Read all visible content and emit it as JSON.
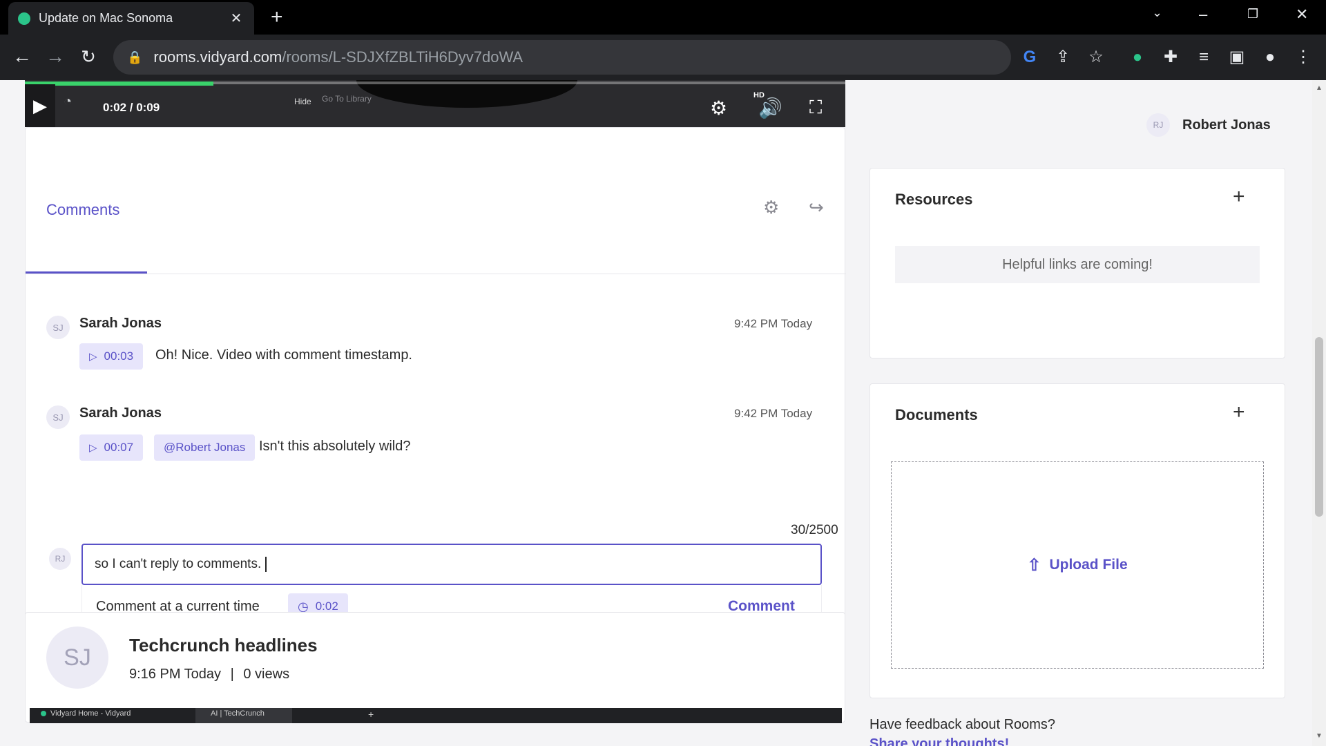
{
  "browser": {
    "tab_title": "Update on Mac Sonoma",
    "tab_close": "✕",
    "new_tab": "+",
    "url_domain": "rooms.vidyard.com",
    "url_path": "/rooms/L-SDJXfZBLTiH6Dyv7doWA"
  },
  "video": {
    "current_time": "0:02 / 0:09",
    "progress": 0.23,
    "hide_label": "Hide",
    "library_label": "Go To Library",
    "hd_label": "HD"
  },
  "comments": {
    "tab_label": "Comments",
    "items": [
      {
        "initials": "SJ",
        "author": "Sarah Jonas",
        "time": "9:42 PM Today",
        "timestamp": "00:03",
        "text": "Oh! Nice. Video with comment timestamp."
      },
      {
        "initials": "SJ",
        "author": "Sarah Jonas",
        "time": "9:42 PM Today",
        "timestamp": "00:07",
        "mention": "@Robert Jonas",
        "text": "Isn't this absolutely wild?"
      }
    ],
    "counter": "30/2500",
    "reply_initials": "RJ",
    "reply_value": "so I can't reply to comments.",
    "current_time_label": "Comment at a current time",
    "current_time_value": "0:02",
    "submit_label": "Comment"
  },
  "next_video": {
    "initials": "SJ",
    "title": "Techcrunch headlines",
    "time": "9:16 PM Today",
    "separator": "|",
    "views": "0 views",
    "thumb_tab1": "Vidyard Home - Vidyard",
    "thumb_tab2": "AI | TechCrunch",
    "thumb_url": "techcrunch.com/category/artificial-intelligence/"
  },
  "sidebar": {
    "user_initials": "RJ",
    "user_name": "Robert Jonas",
    "resources_title": "Resources",
    "resources_empty": "Helpful links are coming!",
    "documents_title": "Documents",
    "upload_label": "Upload File",
    "feedback_text": "Have feedback about Rooms?",
    "feedback_link": "Share your thoughts!"
  },
  "colors": {
    "accent": "#5a52c8",
    "progress": "#3ad36b"
  }
}
